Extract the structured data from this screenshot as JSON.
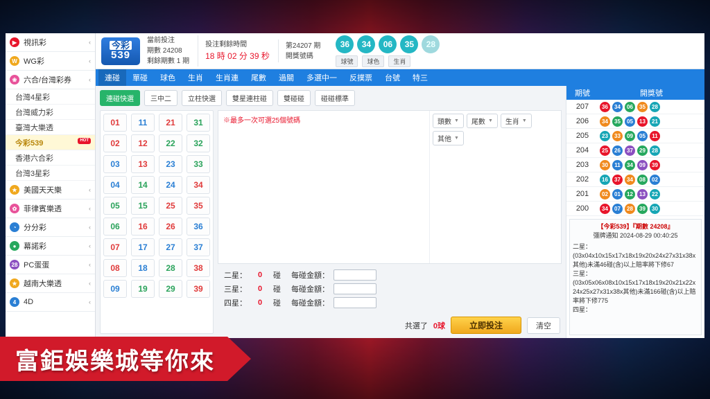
{
  "sidebar": {
    "items": [
      {
        "label": "視訊彩",
        "icon": "play-circle-icon",
        "color": "#e8152b",
        "glyph": "▶",
        "chevron": "‹"
      },
      {
        "label": "WG彩",
        "icon": "w-circle-icon",
        "color": "#f0a81e",
        "glyph": "W",
        "chevron": "‹"
      },
      {
        "label": "六合/台灣彩券",
        "icon": "flower-icon",
        "color": "#e8529a",
        "glyph": "❀",
        "chevron": "‹"
      }
    ],
    "sub_items": [
      {
        "label": "台灣4星彩",
        "active": false,
        "hot": ""
      },
      {
        "label": "台灣威力彩",
        "active": false,
        "hot": ""
      },
      {
        "label": "臺灣大樂透",
        "active": false,
        "hot": ""
      },
      {
        "label": "今彩539",
        "active": true,
        "hot": "HOT"
      },
      {
        "label": "香港六合彩",
        "active": false,
        "hot": ""
      },
      {
        "label": "台灣3星彩",
        "active": false,
        "hot": ""
      }
    ],
    "items2": [
      {
        "label": "美國天天樂",
        "icon": "star-icon",
        "color": "#f0a81e",
        "glyph": "★",
        "chevron": "‹"
      },
      {
        "label": "菲律賓樂透",
        "icon": "globe-icon",
        "color": "#e8529a",
        "glyph": "✿",
        "chevron": "‹"
      },
      {
        "label": "分分彩",
        "icon": "clock-icon",
        "color": "#2a7fd4",
        "glyph": "◔",
        "chevron": "‹"
      },
      {
        "label": "幕諾彩",
        "icon": "circle-icon",
        "color": "#27a85e",
        "glyph": "●",
        "chevron": "‹"
      },
      {
        "label": "PC蛋蛋",
        "icon": "pc28-icon",
        "color": "#8b4fc0",
        "glyph": "28",
        "chevron": "‹"
      },
      {
        "label": "越南大樂透",
        "icon": "star2-icon",
        "color": "#f0a81e",
        "glyph": "★",
        "chevron": "‹"
      },
      {
        "label": "4D",
        "icon": "four-d-icon",
        "color": "#2a7fd4",
        "glyph": "4",
        "chevron": "‹"
      }
    ]
  },
  "header": {
    "logo_top": "今彩",
    "logo_bottom": "539",
    "bet_label": "當前投注",
    "bet_issue": "期數 24208",
    "bet_remain": "剩餘期數 1 期",
    "timer_label": "投注剩餘時間",
    "timer_value": "18 時 02 分 39 秒",
    "draw_issue": "第24207 期",
    "draw_label": "開獎號碼",
    "balls": [
      "36",
      "34",
      "06",
      "35"
    ],
    "ball_dim": "28",
    "tags": [
      "球號",
      "球色",
      "生肖"
    ]
  },
  "nav": {
    "items": [
      {
        "label": "連碰",
        "active": true
      },
      {
        "label": "單碰",
        "active": false
      },
      {
        "label": "球色",
        "active": false
      },
      {
        "label": "生肖",
        "active": false
      },
      {
        "label": "生肖連",
        "active": false
      },
      {
        "label": "尾數",
        "active": false
      },
      {
        "label": "過關",
        "active": false
      },
      {
        "label": "多選中一",
        "active": false
      },
      {
        "label": "反撲票",
        "active": false
      },
      {
        "label": "台號",
        "active": false
      },
      {
        "label": "特三",
        "active": false
      }
    ]
  },
  "toolbar": {
    "chips": [
      {
        "label": "連碰快選",
        "primary": true
      },
      {
        "label": "三中二",
        "primary": false
      },
      {
        "label": "立柱快選",
        "primary": false
      },
      {
        "label": "雙星連柱碰",
        "primary": false
      },
      {
        "label": "雙碰碰",
        "primary": false
      },
      {
        "label": "碰碰標準",
        "primary": false
      }
    ]
  },
  "numbers": [
    {
      "n": "01",
      "c": "red"
    },
    {
      "n": "11",
      "c": "blue"
    },
    {
      "n": "21",
      "c": "red"
    },
    {
      "n": "31",
      "c": "green"
    },
    {
      "n": "02",
      "c": "red"
    },
    {
      "n": "12",
      "c": "red"
    },
    {
      "n": "22",
      "c": "green"
    },
    {
      "n": "32",
      "c": "green"
    },
    {
      "n": "03",
      "c": "blue"
    },
    {
      "n": "13",
      "c": "red"
    },
    {
      "n": "23",
      "c": "blue"
    },
    {
      "n": "33",
      "c": "green"
    },
    {
      "n": "04",
      "c": "blue"
    },
    {
      "n": "14",
      "c": "green"
    },
    {
      "n": "24",
      "c": "blue"
    },
    {
      "n": "34",
      "c": "red"
    },
    {
      "n": "05",
      "c": "green"
    },
    {
      "n": "15",
      "c": "green"
    },
    {
      "n": "25",
      "c": "red"
    },
    {
      "n": "35",
      "c": "red"
    },
    {
      "n": "06",
      "c": "green"
    },
    {
      "n": "16",
      "c": "red"
    },
    {
      "n": "26",
      "c": "red"
    },
    {
      "n": "36",
      "c": "blue"
    },
    {
      "n": "07",
      "c": "red"
    },
    {
      "n": "17",
      "c": "blue"
    },
    {
      "n": "27",
      "c": "blue"
    },
    {
      "n": "37",
      "c": "blue"
    },
    {
      "n": "08",
      "c": "red"
    },
    {
      "n": "18",
      "c": "blue"
    },
    {
      "n": "28",
      "c": "green"
    },
    {
      "n": "38",
      "c": "red"
    },
    {
      "n": "09",
      "c": "blue"
    },
    {
      "n": "19",
      "c": "green"
    },
    {
      "n": "29",
      "c": "green"
    },
    {
      "n": "39",
      "c": "red"
    }
  ],
  "selection": {
    "note": "※最多一次可選25個號碼",
    "dropdowns": [
      "頭數",
      "尾數",
      "生肖",
      "其他"
    ]
  },
  "bet_rows": [
    {
      "label": "二星：",
      "zero": "0",
      "unit": "碰",
      "amount_label": "每碰金額：",
      "value": ""
    },
    {
      "label": "三星：",
      "zero": "0",
      "unit": "碰",
      "amount_label": "每碰金額：",
      "value": ""
    },
    {
      "label": "四星：",
      "zero": "0",
      "unit": "碰",
      "amount_label": "每碰金額：",
      "value": ""
    }
  ],
  "footer": {
    "total_label": "共選了",
    "total_amount": "0球",
    "bet_button": "立即投注",
    "clear_button": "清空"
  },
  "results": {
    "headers": [
      "期號",
      "開獎號"
    ],
    "rows": [
      {
        "issue": "207",
        "balls": [
          {
            "n": "36",
            "c": "m-red"
          },
          {
            "n": "34",
            "c": "m-blue"
          },
          {
            "n": "06",
            "c": "m-green"
          },
          {
            "n": "35",
            "c": "m-orange"
          },
          {
            "n": "28",
            "c": "m-teal"
          }
        ]
      },
      {
        "issue": "206",
        "balls": [
          {
            "n": "34",
            "c": "m-orange"
          },
          {
            "n": "35",
            "c": "m-green"
          },
          {
            "n": "05",
            "c": "m-blue"
          },
          {
            "n": "13",
            "c": "m-red"
          },
          {
            "n": "21",
            "c": "m-teal"
          }
        ]
      },
      {
        "issue": "205",
        "balls": [
          {
            "n": "23",
            "c": "m-teal"
          },
          {
            "n": "33",
            "c": "m-orange"
          },
          {
            "n": "09",
            "c": "m-green"
          },
          {
            "n": "05",
            "c": "m-blue"
          },
          {
            "n": "11",
            "c": "m-red"
          }
        ]
      },
      {
        "issue": "204",
        "balls": [
          {
            "n": "25",
            "c": "m-red"
          },
          {
            "n": "26",
            "c": "m-blue"
          },
          {
            "n": "37",
            "c": "m-purple"
          },
          {
            "n": "29",
            "c": "m-green"
          },
          {
            "n": "28",
            "c": "m-teal"
          }
        ]
      },
      {
        "issue": "203",
        "balls": [
          {
            "n": "30",
            "c": "m-orange"
          },
          {
            "n": "11",
            "c": "m-blue"
          },
          {
            "n": "34",
            "c": "m-green"
          },
          {
            "n": "09",
            "c": "m-purple"
          },
          {
            "n": "39",
            "c": "m-red"
          }
        ]
      },
      {
        "issue": "202",
        "balls": [
          {
            "n": "16",
            "c": "m-teal"
          },
          {
            "n": "37",
            "c": "m-red"
          },
          {
            "n": "34",
            "c": "m-orange"
          },
          {
            "n": "08",
            "c": "m-green"
          },
          {
            "n": "02",
            "c": "m-blue"
          }
        ]
      },
      {
        "issue": "201",
        "balls": [
          {
            "n": "02",
            "c": "m-orange"
          },
          {
            "n": "01",
            "c": "m-blue"
          },
          {
            "n": "12",
            "c": "m-green"
          },
          {
            "n": "13",
            "c": "m-purple"
          },
          {
            "n": "22",
            "c": "m-teal"
          }
        ]
      },
      {
        "issue": "200",
        "balls": [
          {
            "n": "34",
            "c": "m-red"
          },
          {
            "n": "07",
            "c": "m-blue"
          },
          {
            "n": "28",
            "c": "m-orange"
          },
          {
            "n": "39",
            "c": "m-green"
          },
          {
            "n": "30",
            "c": "m-teal"
          }
        ]
      }
    ]
  },
  "notice": {
    "title": "【今彩539】『期數 24208』",
    "subtitle": "彊牌通知 2024-08-29 00:40:25",
    "body": "二星：\n(03x04x10x15x17x18x19x20x24x27x31x38x其他)未滿46碰(含)以上賠率將下修67\n三星：\n(03x05x06x08x10x15x17x18x19x20x21x22x24x25x27x31x38x其他)未滿166碰(含)以上賠率將下修775\n四星："
  },
  "banner": {
    "text": "富鉅娛樂城等你來"
  }
}
